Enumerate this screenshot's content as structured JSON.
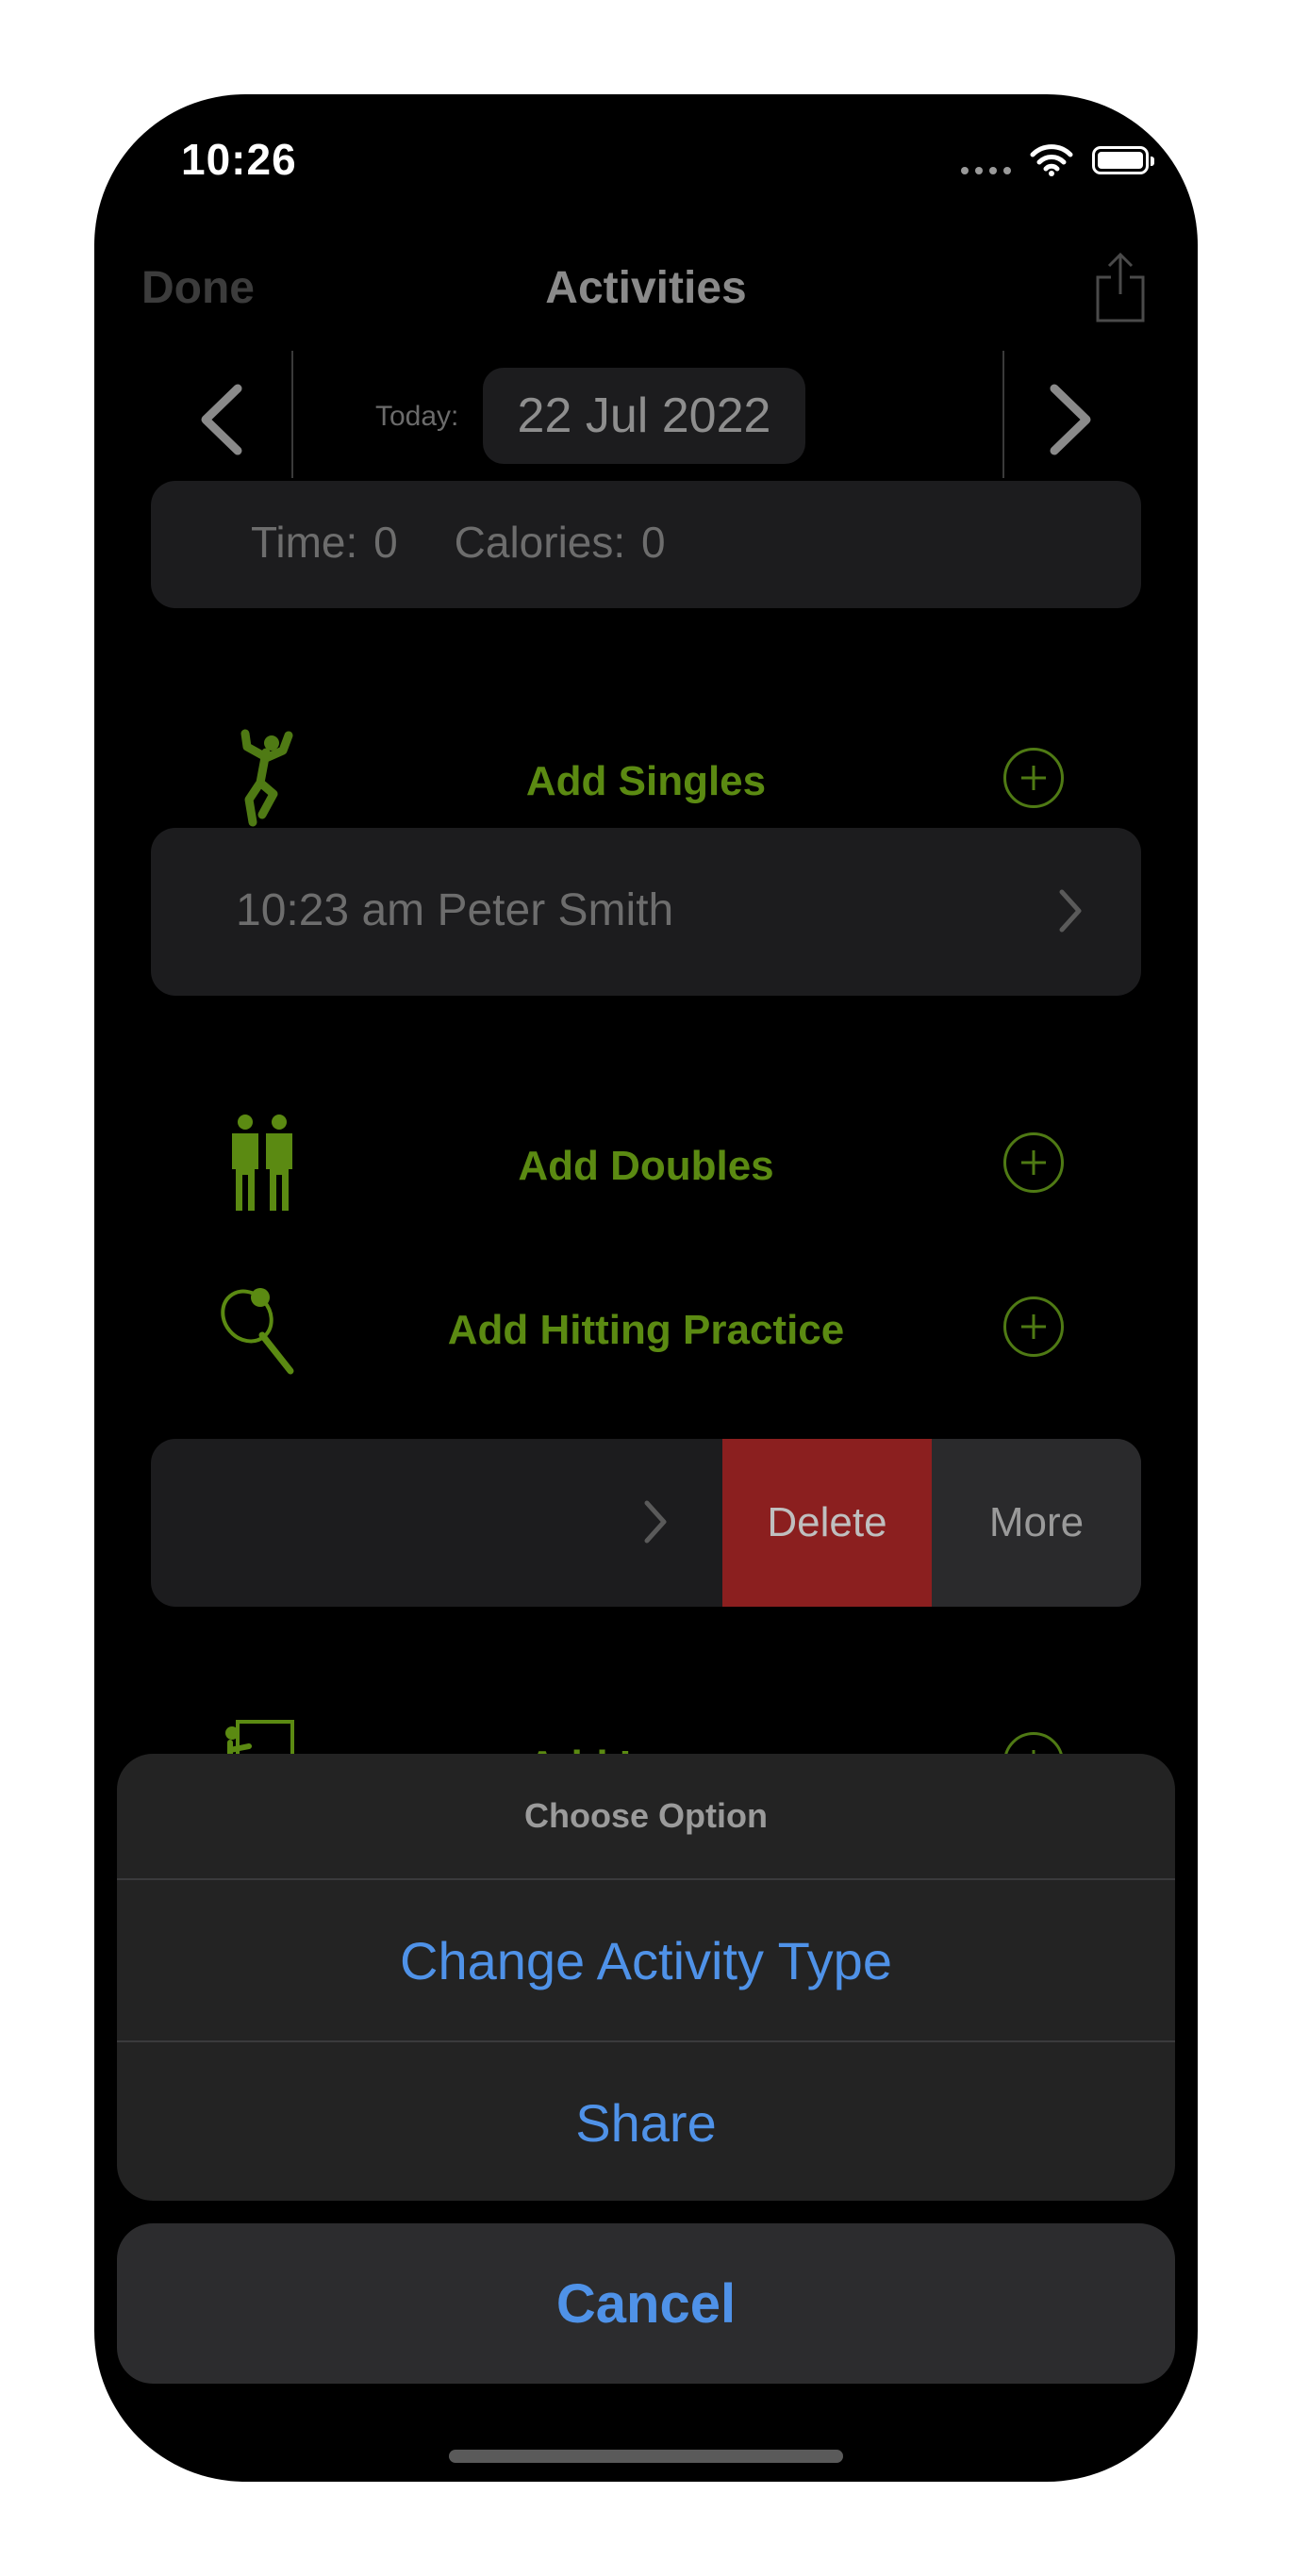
{
  "status_bar": {
    "time": "10:26"
  },
  "navbar": {
    "done_label": "Done",
    "title": "Activities"
  },
  "date_bar": {
    "today_label": "Today:",
    "date": "22 Jul 2022"
  },
  "summary": {
    "time": "Time: 0",
    "calories": "Calories: 0"
  },
  "activities": [
    {
      "label": "Add Singles",
      "icon": "singles-player-icon"
    },
    {
      "label": "Add Doubles",
      "icon": "doubles-players-icon"
    },
    {
      "label": "Add Hitting Practice",
      "icon": "racket-ball-icon"
    },
    {
      "label": "Add Lesson",
      "icon": "lesson-board-icon"
    }
  ],
  "singles_entry": {
    "text": "10:23 am Peter Smith"
  },
  "swipe_actions": {
    "delete_label": "Delete",
    "more_label": "More"
  },
  "action_sheet": {
    "title": "Choose Option",
    "options": [
      "Change Activity Type",
      "Share"
    ],
    "cancel_label": "Cancel"
  },
  "colors": {
    "accent_green": "#5b8a12",
    "action_blue": "#4f92e8",
    "delete_red": "#8b1f1f"
  }
}
